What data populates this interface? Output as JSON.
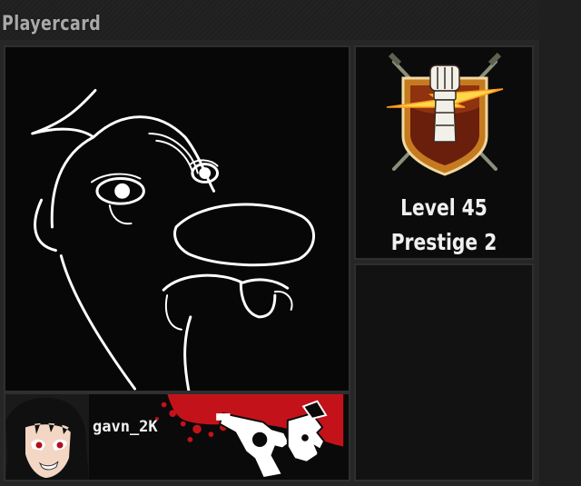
{
  "section": {
    "title": "Playercard"
  },
  "player": {
    "gamertag": "gavn_2K",
    "level_label": "Level 45",
    "prestige_label": "Prestige 2"
  },
  "icons": {
    "emblem": "cartoon-face-emblem",
    "rank": "prestige-fist-rank-icon",
    "avatar": "anime-character-avatar",
    "calling_card": "revolver-calling-card"
  },
  "colors": {
    "background": "#1b1b1b",
    "panel": "#0b0b0b",
    "text": "#f0f0f0",
    "title": "#a9a9a9",
    "calling_red": "#c4121a"
  }
}
